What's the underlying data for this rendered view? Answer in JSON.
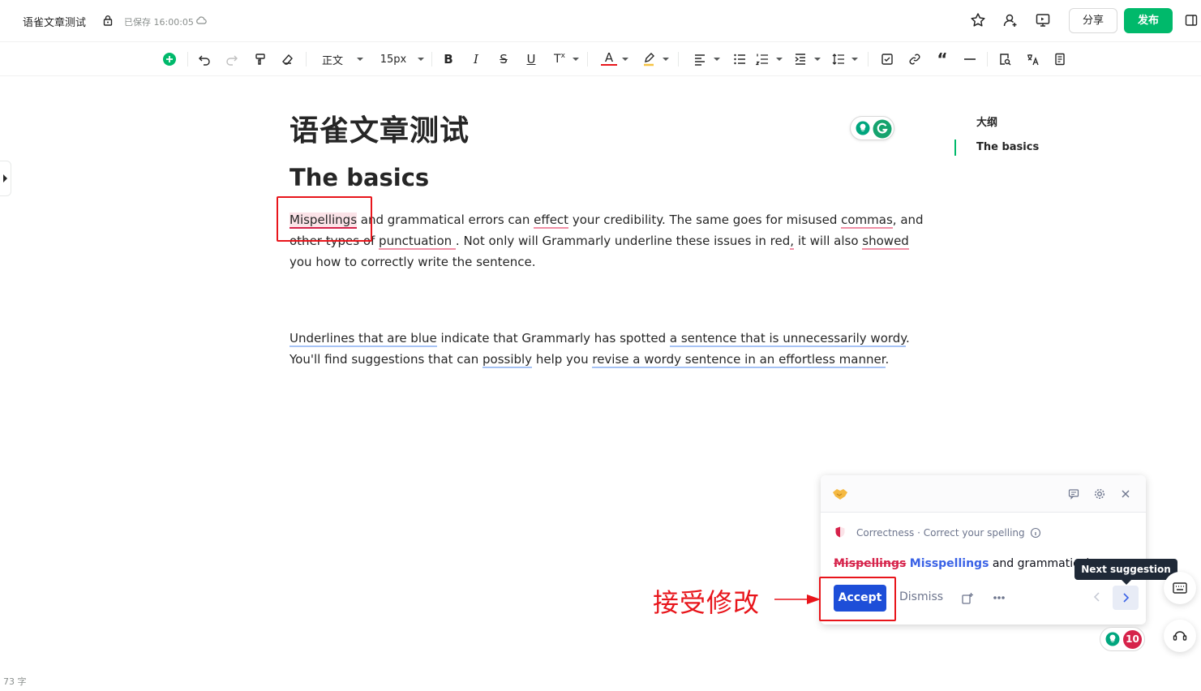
{
  "topbar": {
    "doc_name": "语雀文章测试",
    "saved_status": "已保存 16:00:05",
    "share_label": "分享",
    "publish_label": "发布"
  },
  "toolbar": {
    "style_label": "正文",
    "font_size_label": "15px"
  },
  "document": {
    "title": "语雀文章测试",
    "heading": "The basics",
    "para1": {
      "l1a": "Mispellings",
      "l1b": " and grammatical errors can ",
      "l1c": "effect",
      "l1d": " your credibility. The same goes for misused ",
      "l1e": "commas",
      "l1f": ", and",
      "l2a": "other types of ",
      "l2b": "punctuation ",
      "l2c": ". Not only will Grammarly underline these issues in red",
      "l2d": ",",
      "l2e": " it will also ",
      "l2f": "showed",
      "l3": "you how to correctly write the sentence."
    },
    "para2": {
      "l1a": "Underlines that are blue",
      "l1b": " indicate that Grammarly has spotted ",
      "l1c": "a sentence that is unnecessarily wordy",
      "l1d": ".",
      "l2a": "You'll find suggestions that can ",
      "l2b": "possibly",
      "l2c": " help you ",
      "l2d": "revise a wordy sentence in an effortless manner",
      "l2e": "."
    }
  },
  "outline": {
    "title": "大纲",
    "items": [
      "The basics"
    ]
  },
  "grammarly_card": {
    "category": "Correctness · Correct your spelling",
    "wrong": "Mispellings",
    "right": "Misspellings",
    "rest": " and grammatical...",
    "accept_label": "Accept",
    "dismiss_label": "Dismiss",
    "tooltip": "Next suggestion"
  },
  "grammarly_count": "10",
  "annotation": "接受修改",
  "word_count": "73 字",
  "colors": {
    "brand_green": "#00b96b",
    "accept_blue": "#1d4ed8",
    "error_red": "#d6224a",
    "annotation_red": "#e8151b"
  }
}
